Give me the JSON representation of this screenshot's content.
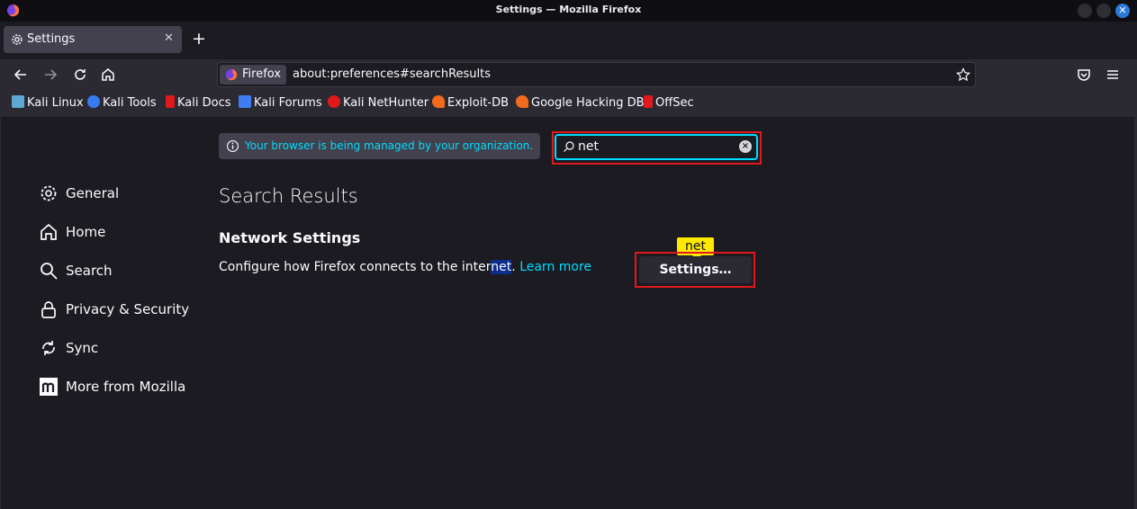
{
  "window": {
    "title": "Settings — Mozilla Firefox",
    "close_glyph": "✕"
  },
  "tabs": [
    {
      "label": "Settings",
      "close_glyph": "✕",
      "icon": "gear-icon"
    }
  ],
  "new_tab_glyph": "+",
  "navbar": {
    "identity_label": "Firefox",
    "url": "about:preferences#searchResults"
  },
  "bookmarks": [
    {
      "label": "Kali Linux",
      "icon": "kali-icon",
      "color": "#5fa8d3"
    },
    {
      "label": "Kali Tools",
      "icon": "kali-tools-icon",
      "color": "#367bf0"
    },
    {
      "label": "Kali Docs",
      "icon": "kali-docs-icon",
      "color": "#e0191b"
    },
    {
      "label": "Kali Forums",
      "icon": "kali-forums-icon",
      "color": "#3f7ef2"
    },
    {
      "label": "Kali NetHunter",
      "icon": "nethunter-icon",
      "color": "#e0191b"
    },
    {
      "label": "Exploit-DB",
      "icon": "exploit-db-icon",
      "color": "#f26b1d"
    },
    {
      "label": "Google Hacking DB",
      "icon": "ghdb-icon",
      "color": "#f26b1d"
    },
    {
      "label": "OffSec",
      "icon": "offsec-icon",
      "color": "#e0191b"
    }
  ],
  "banner": {
    "text": "Your browser is being managed by your organization."
  },
  "search": {
    "value": "net"
  },
  "sidebar": {
    "items": [
      {
        "label": "General",
        "icon": "gear-icon"
      },
      {
        "label": "Home",
        "icon": "home-icon"
      },
      {
        "label": "Search",
        "icon": "search-icon"
      },
      {
        "label": "Privacy & Security",
        "icon": "lock-icon"
      },
      {
        "label": "Sync",
        "icon": "sync-icon"
      },
      {
        "label": "More from Mozilla",
        "icon": "mozilla-icon"
      }
    ]
  },
  "results": {
    "title": "Search Results",
    "group_title": "Network Settings",
    "description_before": "Configure how Firefox connects to the inter",
    "description_highlight": "net",
    "description_after": ".",
    "learn_more": "Learn more",
    "tooltip": "net",
    "settings_button": "Settings…"
  },
  "colors": {
    "accent": "#00ddff",
    "annotation_outline": "#e0191b",
    "tooltip": "#ffe900",
    "highlight": "#0b2e8a"
  }
}
